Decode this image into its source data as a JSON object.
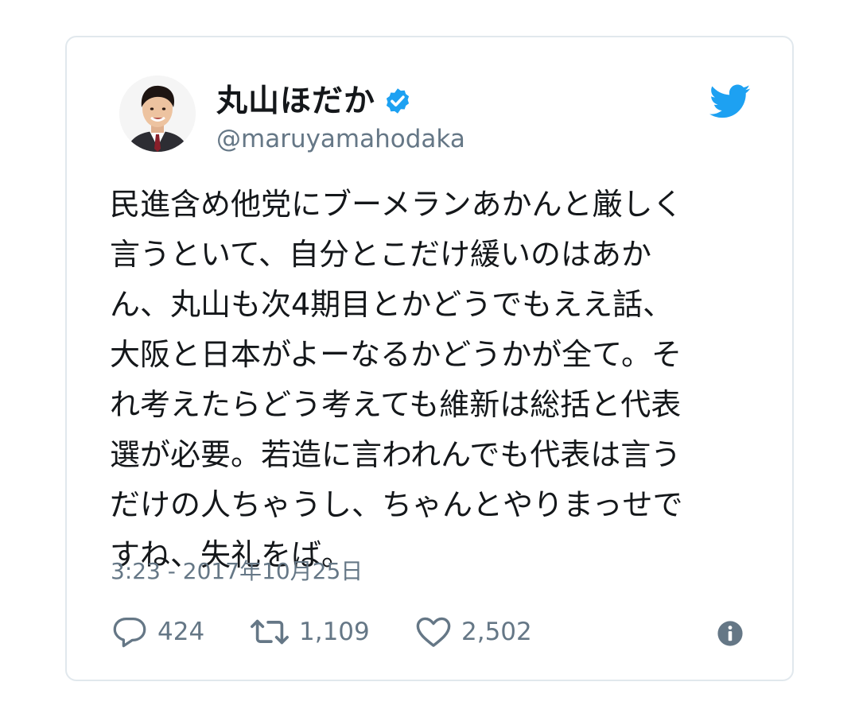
{
  "tweet": {
    "author": {
      "display_name": "丸山ほだか",
      "handle": "@maruyamahodaka",
      "verified": true
    },
    "text_lines": [
      "民進含め他党にブーメランあかんと厳しく",
      "言うといて、自分とこだけ緩いのはあか",
      "ん、丸山も次4期目とかどうでもええ話、",
      "大阪と日本がよーなるかどうかが全て。そ",
      "れ考えたらどう考えても維新は総括と代表",
      "選が必要。若造に言われんでも代表は言う",
      "だけの人ちゃうし、ちゃんとやりまっせで",
      "すね、失礼をば。"
    ],
    "timestamp": "3:23 - 2017年10月25日",
    "stats": {
      "replies": "424",
      "retweets": "1,109",
      "likes": "2,502"
    }
  },
  "icons": {
    "verified": "verified-badge-icon",
    "brand": "twitter-bird-icon",
    "reply": "reply-icon",
    "retweet": "retweet-icon",
    "like": "heart-icon",
    "info": "info-icon"
  },
  "colors": {
    "twitter_blue": "#1da1f2",
    "text_primary": "#14171a",
    "text_secondary": "#657786",
    "card_border": "#e1e8ed"
  }
}
